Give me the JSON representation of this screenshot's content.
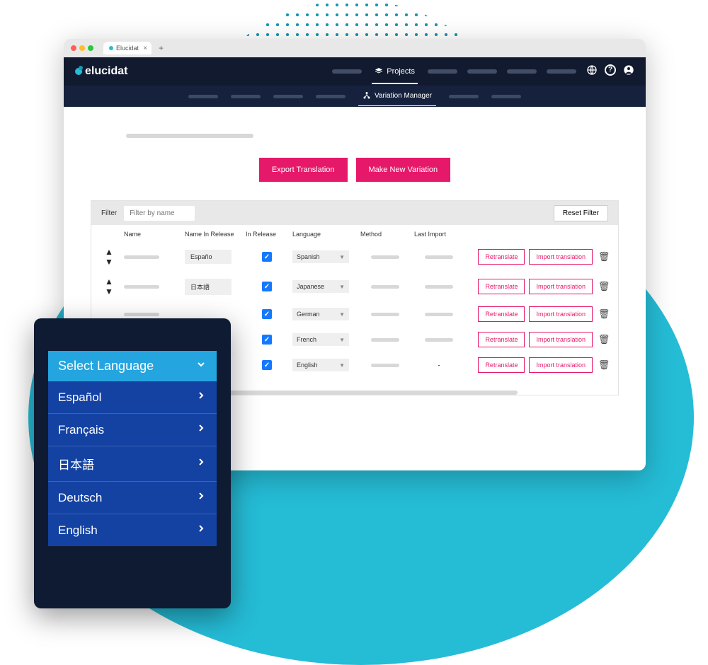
{
  "browser": {
    "tab_title": "Elucidat"
  },
  "header": {
    "brand": "elucidat",
    "active_nav": "Projects"
  },
  "subheader": {
    "active": "Variation Manager"
  },
  "cta": {
    "export": "Export Translation",
    "make_new": "Make New Variation"
  },
  "filter": {
    "label": "Filter",
    "placeholder": "Filter by name",
    "reset": "Reset Filter"
  },
  "columns": {
    "name": "Name",
    "name_in_release": "Name In Release",
    "in_release": "In Release",
    "language": "Language",
    "method": "Method",
    "last_import": "Last Import"
  },
  "row_actions": {
    "retranslate": "Retranslate",
    "import": "Import translation"
  },
  "rows": [
    {
      "name_in_release": "Españo",
      "in_release": true,
      "language": "Spanish",
      "last_import": ""
    },
    {
      "name_in_release": "日本語",
      "in_release": true,
      "language": "Japanese",
      "last_import": ""
    },
    {
      "name_in_release": "",
      "in_release": true,
      "language": "German",
      "last_import": ""
    },
    {
      "name_in_release": "",
      "in_release": true,
      "language": "French",
      "last_import": ""
    },
    {
      "name_in_release": "",
      "in_release": true,
      "language": "English",
      "last_import": "-"
    }
  ],
  "lang_card": {
    "header": "Select Language",
    "items": [
      "Español",
      "Français",
      "日本語",
      "Deutsch",
      "English"
    ]
  }
}
